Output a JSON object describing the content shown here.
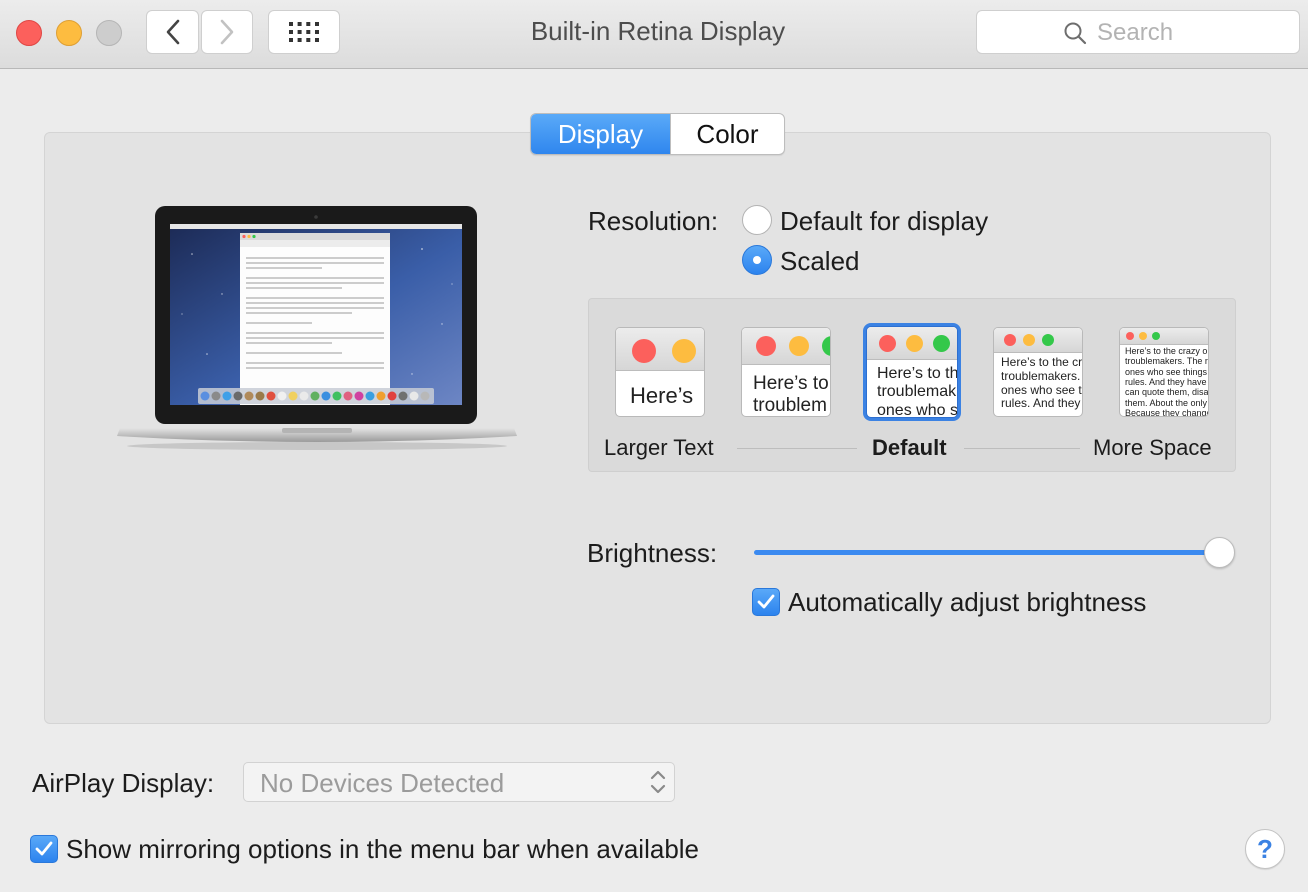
{
  "window": {
    "title": "Built-in Retina Display",
    "search_placeholder": "Search"
  },
  "tabs": [
    {
      "label": "Display",
      "selected": true
    },
    {
      "label": "Color",
      "selected": false
    }
  ],
  "resolution": {
    "label": "Resolution:",
    "options": [
      {
        "label": "Default for display",
        "selected": false
      },
      {
        "label": "Scaled",
        "selected": true
      }
    ]
  },
  "scaling": {
    "thumbnails": [
      {
        "text": "Here’s",
        "selected": false
      },
      {
        "text": "Here’s to\ntroublem",
        "selected": false
      },
      {
        "text": "Here’s to th\ntroublemak\nones who s",
        "selected": true
      },
      {
        "text": "Here’s to the cr\ntroublemakers.\nones who see t\nrules. And they",
        "selected": false
      },
      {
        "text": "Here’s to the crazy one\ntroublemakers. The rou\nones who see things di\nrules. And they have no\ncan quote them, disagre\nthem. About the only th\nBecause they change th",
        "selected": false
      }
    ],
    "label_left": "Larger Text",
    "label_center": "Default",
    "label_right": "More Space"
  },
  "brightness": {
    "label": "Brightness:",
    "level": 0.97,
    "auto_label": "Automatically adjust brightness",
    "auto_checked": true
  },
  "airplay": {
    "label": "AirPlay Display:",
    "value": "No Devices Detected"
  },
  "mirroring": {
    "label": "Show mirroring options in the menu bar when available",
    "checked": true
  },
  "help_label": "?",
  "colors": {
    "accent": "#3b8af0",
    "close": "#fc605c",
    "minimize": "#fdbc40",
    "zoom_inactive": "#cdcdcd"
  },
  "icons": [
    "chevron-left-icon",
    "chevron-right-icon",
    "grid-icon",
    "search-icon",
    "laptop-image",
    "checkmark-icon",
    "updown-arrows-icon",
    "help-icon"
  ]
}
